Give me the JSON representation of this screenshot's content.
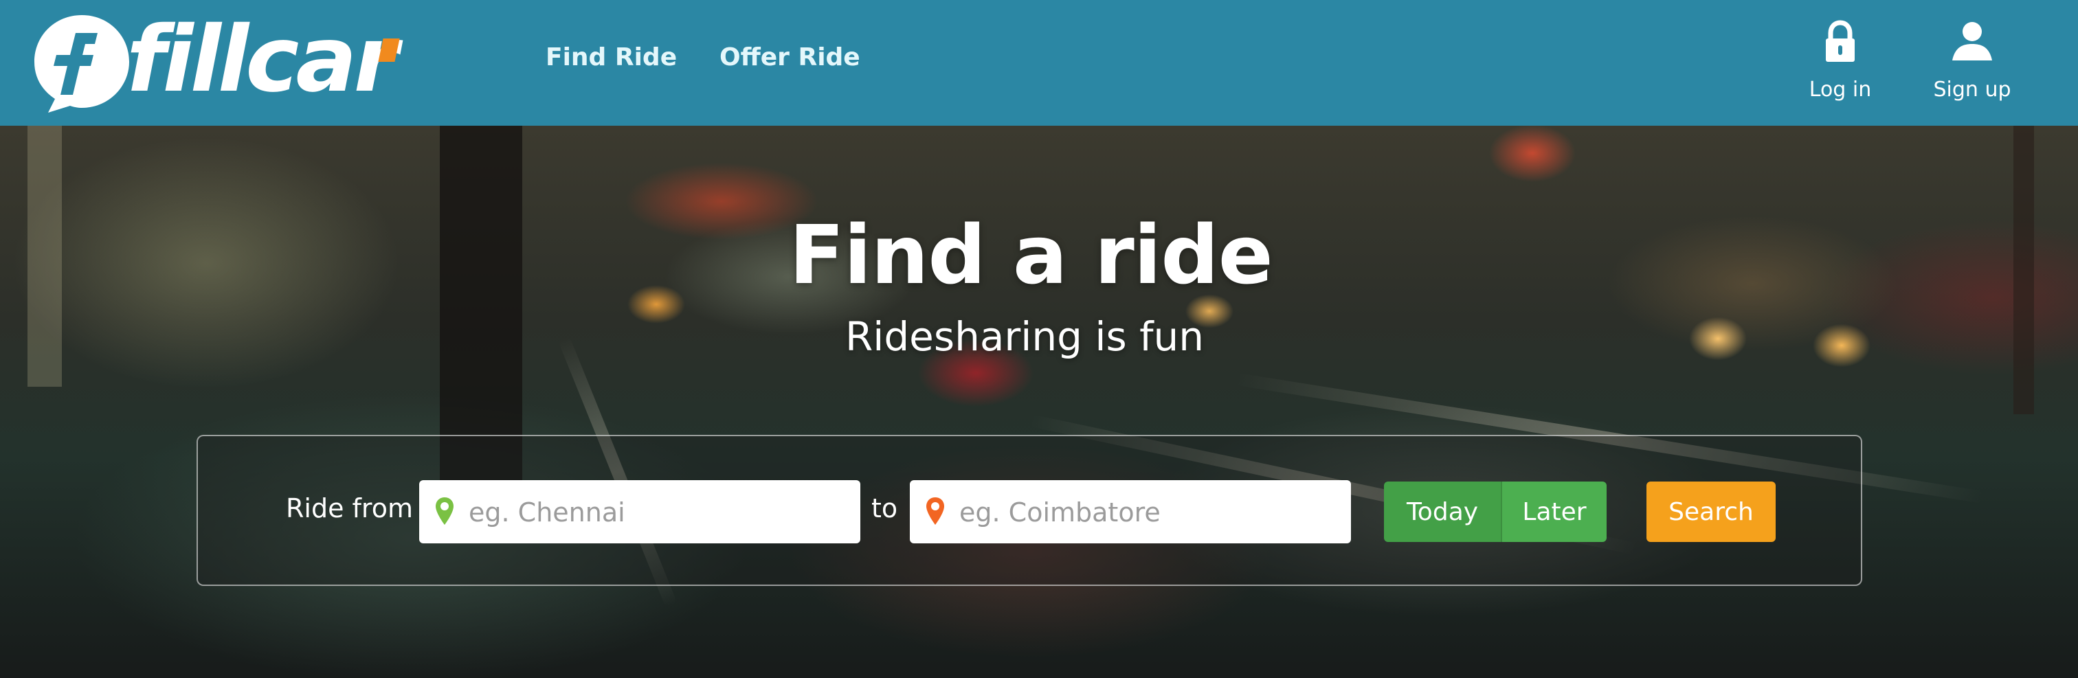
{
  "header": {
    "logo_text": "fillcar",
    "nav": {
      "find_ride": "Find Ride",
      "offer_ride": "Offer Ride"
    },
    "account": {
      "login_label": "Log in",
      "signup_label": "Sign up",
      "login_icon": "lock-icon",
      "signup_icon": "user-icon"
    }
  },
  "hero": {
    "title": "Find a ride",
    "subtitle": "Ridesharing is fun"
  },
  "search": {
    "ride_from_label": "Ride from",
    "from_placeholder": "eg. Chennai",
    "from_value": "",
    "to_label": "to",
    "to_placeholder": "eg. Coimbatore",
    "to_value": "",
    "today_label": "Today",
    "later_label": "Later",
    "search_label": "Search"
  },
  "colors": {
    "header_bg": "#2b87a4",
    "from_pin": "#7ac143",
    "to_pin": "#f26522",
    "toggle_green": "#4caf50",
    "search_orange": "#f5a11c"
  }
}
